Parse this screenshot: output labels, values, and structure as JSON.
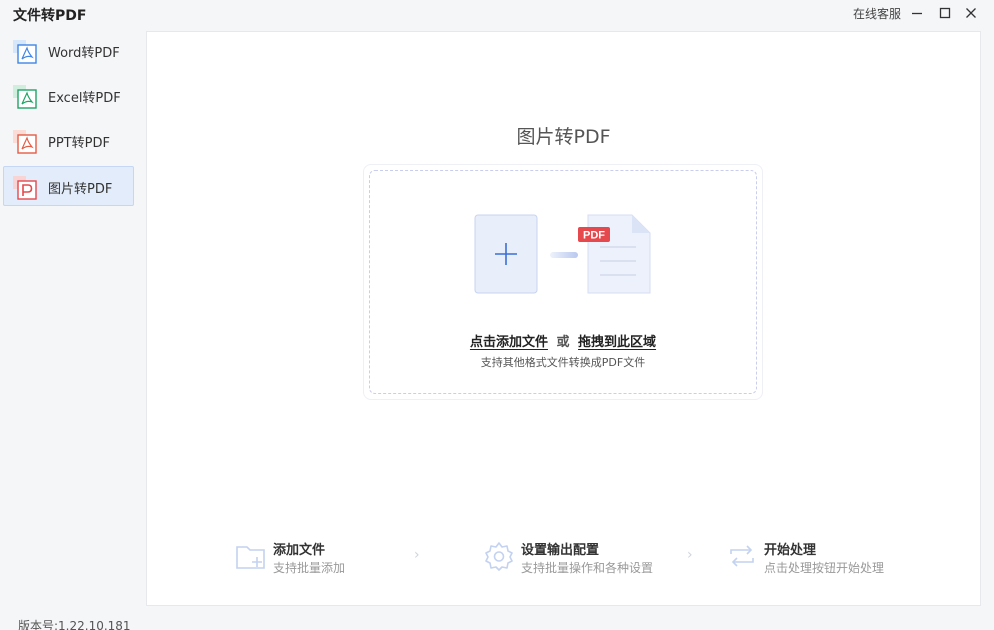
{
  "app": {
    "title": "文件转PDF",
    "support_label": "在线客服",
    "version": "版本号:1.22.10.181"
  },
  "sidebar": {
    "items": [
      {
        "label": "Word转PDF",
        "icon": "word-to-pdf-icon",
        "color": "#3f86e6",
        "active": false
      },
      {
        "label": "Excel转PDF",
        "icon": "excel-to-pdf-icon",
        "color": "#21a366",
        "active": false
      },
      {
        "label": "PPT转PDF",
        "icon": "ppt-to-pdf-icon",
        "color": "#e55c45",
        "active": false
      },
      {
        "label": "图片转PDF",
        "icon": "image-to-pdf-icon",
        "color": "#e5484d",
        "active": true
      }
    ]
  },
  "main": {
    "title": "图片转PDF",
    "drop": {
      "click_add": "点击添加文件",
      "or": "或",
      "drag_here": "拖拽到此区域",
      "hint": "支持其他格式文件转换成PDF文件",
      "badge": "PDF"
    },
    "steps": [
      {
        "title": "添加文件",
        "desc": "支持批量添加",
        "icon": "folder-add-icon"
      },
      {
        "title": "设置输出配置",
        "desc": "支持批量操作和各种设置",
        "icon": "gear-icon"
      },
      {
        "title": "开始处理",
        "desc": "点击处理按钮开始处理",
        "icon": "repeat-icon"
      }
    ],
    "step_arrow": "›"
  },
  "colors": {
    "accent": "#3b6fd8",
    "pdf_red": "#e5484d",
    "active_bg": "#e3ecfa"
  }
}
